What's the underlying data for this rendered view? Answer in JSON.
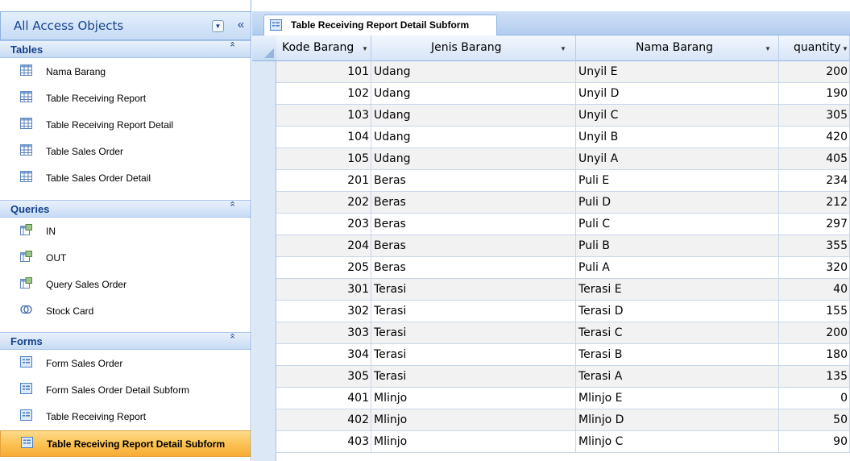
{
  "nav": {
    "title": "All Access Objects",
    "groups": [
      {
        "title": "Tables",
        "items": [
          {
            "label": "Nama Barang",
            "icon": "table-icon"
          },
          {
            "label": "Table Receiving Report",
            "icon": "table-icon"
          },
          {
            "label": "Table Receiving Report Detail",
            "icon": "table-icon"
          },
          {
            "label": "Table Sales Order",
            "icon": "table-icon"
          },
          {
            "label": "Table Sales Order Detail",
            "icon": "table-icon"
          }
        ]
      },
      {
        "title": "Queries",
        "items": [
          {
            "label": "IN",
            "icon": "query-icon"
          },
          {
            "label": "OUT",
            "icon": "query-icon"
          },
          {
            "label": "Query Sales Order",
            "icon": "query-icon"
          },
          {
            "label": "Stock Card",
            "icon": "union-query-icon"
          }
        ]
      },
      {
        "title": "Forms",
        "items": [
          {
            "label": "Form Sales Order",
            "icon": "form-icon"
          },
          {
            "label": "Form Sales Order Detail Subform",
            "icon": "form-icon"
          },
          {
            "label": "Table Receiving Report",
            "icon": "form-icon"
          },
          {
            "label": "Table Receiving Report Detail Subform",
            "icon": "form-icon",
            "selected": true
          }
        ]
      }
    ]
  },
  "document": {
    "tab_label": "Table Receiving Report Detail Subform"
  },
  "grid": {
    "columns": [
      "Kode Barang",
      "Jenis Barang",
      "Nama Barang",
      "quantity"
    ],
    "rows": [
      [
        "101",
        "Udang",
        "Unyil E",
        "200"
      ],
      [
        "102",
        "Udang",
        "Unyil D",
        "190"
      ],
      [
        "103",
        "Udang",
        "Unyil C",
        "305"
      ],
      [
        "104",
        "Udang",
        "Unyil B",
        "420"
      ],
      [
        "105",
        "Udang",
        "Unyil A",
        "405"
      ],
      [
        "201",
        "Beras",
        "Puli E",
        "234"
      ],
      [
        "202",
        "Beras",
        "Puli D",
        "212"
      ],
      [
        "203",
        "Beras",
        "Puli C",
        "297"
      ],
      [
        "204",
        "Beras",
        "Puli B",
        "355"
      ],
      [
        "205",
        "Beras",
        "Puli A",
        "320"
      ],
      [
        "301",
        "Terasi",
        "Terasi E",
        "40"
      ],
      [
        "302",
        "Terasi",
        "Terasi D",
        "155"
      ],
      [
        "303",
        "Terasi",
        "Terasi C",
        "200"
      ],
      [
        "304",
        "Terasi",
        "Terasi B",
        "180"
      ],
      [
        "305",
        "Terasi",
        "Terasi A",
        "135"
      ],
      [
        "401",
        "Mlinjo",
        "Mlinjo E",
        "0"
      ],
      [
        "402",
        "Mlinjo",
        "Mlinjo D",
        "50"
      ],
      [
        "403",
        "Mlinjo",
        "Mlinjo C",
        "90"
      ]
    ]
  },
  "colors": {
    "accent": "#15428b",
    "selected_item": "#fbc354",
    "border": "#8db2e3"
  }
}
